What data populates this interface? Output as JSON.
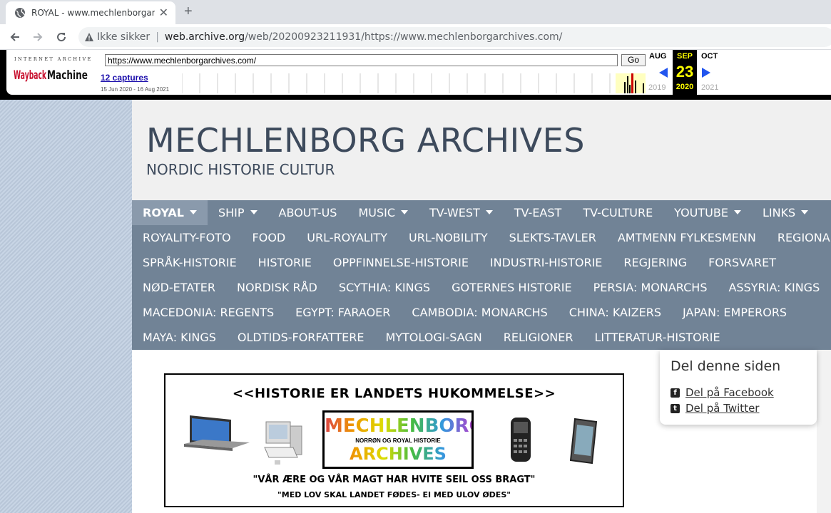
{
  "browser": {
    "tab_title": "ROYAL - www.mechlenborgarchiv",
    "new_tab": "+",
    "close": "✕",
    "insecure_label": "Ikke sikker",
    "url_host": "web.archive.org",
    "url_path": "/web/20200923211931/https://www.mechlenborgarchives.com/"
  },
  "wayback": {
    "logo_top": "INTERNET ARCHIVE",
    "logo": "WaybackMachine",
    "url_value": "https://www.mechlenborgarchives.com/",
    "go_label": "Go",
    "captures": "12 captures",
    "range": "15 Jun 2020 - 16 Aug 2021",
    "prev_month": "AUG",
    "sel_month": "SEP",
    "next_month": "OCT",
    "sel_day": "23",
    "prev_year": "2019",
    "sel_year": "2020",
    "next_year": "2021"
  },
  "site": {
    "title": "MECHLENBORG ARCHIVES",
    "subtitle": "NORDIC HISTORIE CULTUR"
  },
  "nav": {
    "row1": [
      {
        "label": "ROYAL",
        "dropdown": true,
        "active": true
      },
      {
        "label": "SHIP",
        "dropdown": true
      },
      {
        "label": "ABOUT-US",
        "dropdown": false
      },
      {
        "label": "MUSIC",
        "dropdown": true
      },
      {
        "label": "TV-WEST",
        "dropdown": true
      },
      {
        "label": "TV-EAST",
        "dropdown": false
      },
      {
        "label": "TV-CULTURE",
        "dropdown": false
      },
      {
        "label": "YOUTUBE",
        "dropdown": true
      },
      {
        "label": "LINKS",
        "dropdown": true
      }
    ],
    "row2": [
      "ROYALITY-FOTO",
      "FOOD",
      "URL-ROYALITY",
      "URL-NOBILITY",
      "SLEKTS-TAVLER",
      "AMTMENN FYLKESMENN",
      "REGIONAL"
    ],
    "row3": [
      "SPRÅK-HISTORIE",
      "HISTORIE",
      "OPPFINNELSE-HISTORIE",
      "INDUSTRI-HISTORIE",
      "REGJERING",
      "FORSVARET"
    ],
    "row4": [
      "NØD-ETATER",
      "NORDISK RÅD",
      "SCYTHIA: KINGS",
      "GOTERNES HISTORIE",
      "PERSIA: MONARCHS",
      "ASSYRIA: KINGS"
    ],
    "row5": [
      "MACEDONIA: REGENTS",
      "EGYPT: FARAOER",
      "CAMBODIA: MONARCHS",
      "CHINA: KAIZERS",
      "JAPAN: EMPERORS"
    ],
    "row6": [
      "MAYA: KINGS",
      "OLDTIDS-FORFATTERE",
      "MYTOLOGI-SAGN",
      "RELIGIONER",
      "LITTERATUR-HISTORIE"
    ]
  },
  "banner": {
    "headline": "<<HISTORIE ER LANDETS HUKOMMELSE>>",
    "logo_line1": "MECHLENBORG",
    "logo_line2": "NORRØN OG ROYAL HISTORIE",
    "logo_line3": "ARCHIVES",
    "motto1": "\"VÅR ÆRE OG VÅR MAGT HAR HVITE SEIL OSS BRAGT\"",
    "motto2": "\"MED LOV SKAL LANDET FØDES- EI MED ULOV ØDES\""
  },
  "share": {
    "title": "Del denne siden",
    "facebook": "Del på Facebook",
    "twitter": "Del på Twitter",
    "facebook_icon": "f",
    "twitter_icon": "t"
  },
  "colors": {
    "nav_bg": "#718396",
    "nav_active": "#8a9aac",
    "title": "#3d4a5c",
    "wayback_year": "#ffff00"
  }
}
